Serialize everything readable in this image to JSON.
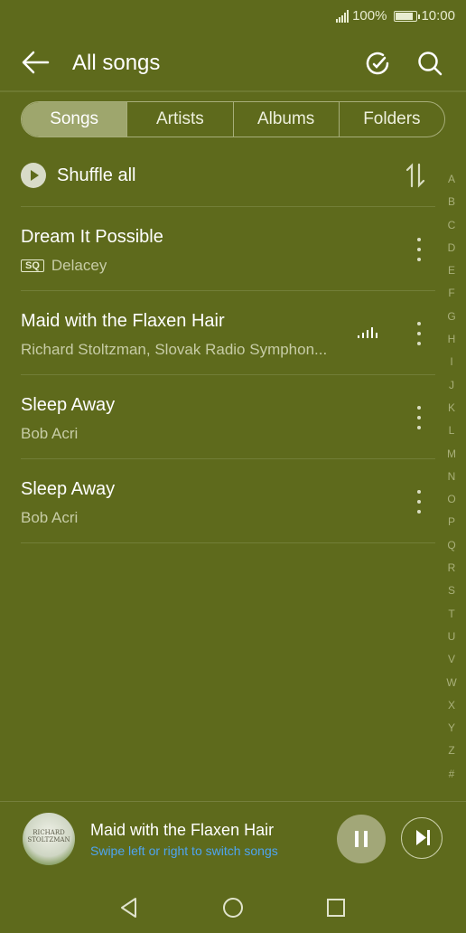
{
  "status": {
    "battery": "100%",
    "time": "10:00"
  },
  "header": {
    "title": "All songs"
  },
  "tabs": [
    {
      "label": "Songs"
    },
    {
      "label": "Artists"
    },
    {
      "label": "Albums"
    },
    {
      "label": "Folders"
    }
  ],
  "shuffle": {
    "label": "Shuffle all"
  },
  "alpha_index": [
    "A",
    "B",
    "C",
    "D",
    "E",
    "F",
    "G",
    "H",
    "I",
    "J",
    "K",
    "L",
    "M",
    "N",
    "O",
    "P",
    "Q",
    "R",
    "S",
    "T",
    "U",
    "V",
    "W",
    "X",
    "Y",
    "Z",
    "#"
  ],
  "songs": [
    {
      "title": "Dream It Possible",
      "artist": "Delacey",
      "badge": "SQ"
    },
    {
      "title": "Maid with the Flaxen Hair",
      "artist": "Richard Stoltzman, Slovak Radio Symphon...",
      "playing": true
    },
    {
      "title": "Sleep Away",
      "artist": "Bob Acri"
    },
    {
      "title": "Sleep Away",
      "artist": "Bob Acri"
    }
  ],
  "player": {
    "album_art_text": "RICHARD STOLTZMAN",
    "title": "Maid with the Flaxen Hair",
    "hint": "Swipe left or right to switch songs"
  },
  "colors": {
    "background": "#5e6a1c",
    "hint": "#4ea4f0",
    "active_tab": "#9ea66d"
  }
}
